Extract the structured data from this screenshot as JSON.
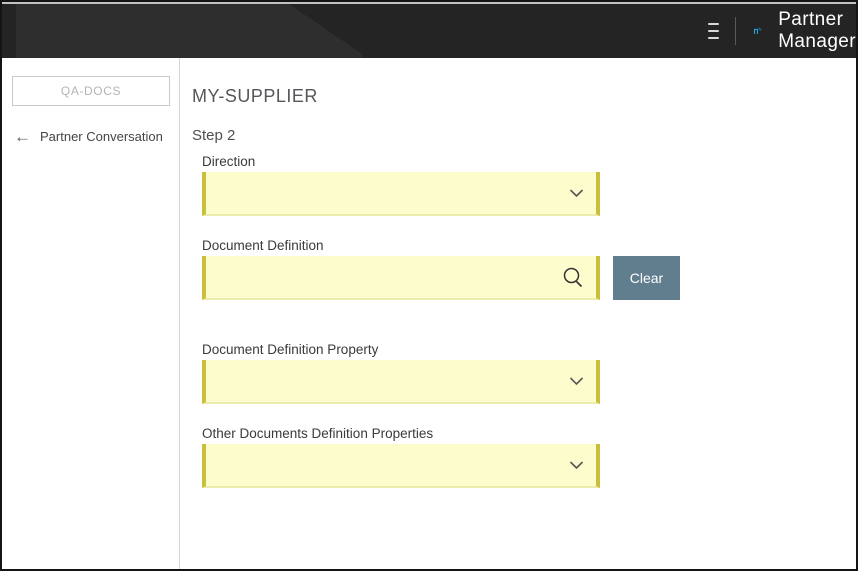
{
  "header": {
    "title": "Partner Manager"
  },
  "sidebar": {
    "partner_button_label": "QA-DOCS",
    "back_arrow_glyph": "←",
    "back_link_label": "Partner Conversation"
  },
  "main": {
    "title": "MY-SUPPLIER",
    "step_title": "Step 2",
    "fields": [
      {
        "label": "Direction",
        "type": "select",
        "value": "",
        "icon": "chevron-down-icon"
      },
      {
        "label": "Document Definition",
        "type": "search",
        "value": "",
        "icon": "search-icon",
        "button_label": "Clear"
      },
      {
        "label": "Document Definition Property",
        "type": "select",
        "value": "",
        "icon": "chevron-down-icon"
      },
      {
        "label": "Other Documents Definition Properties",
        "type": "select",
        "value": "",
        "icon": "chevron-down-icon"
      }
    ]
  },
  "colors": {
    "header_bg": "#242424",
    "field_bg": "#fcfccd",
    "field_border": "#c9bf3a",
    "clear_button_bg": "#617e8f",
    "logo_blue_light": "#2aa9df",
    "logo_blue_dark": "#156f9f"
  }
}
